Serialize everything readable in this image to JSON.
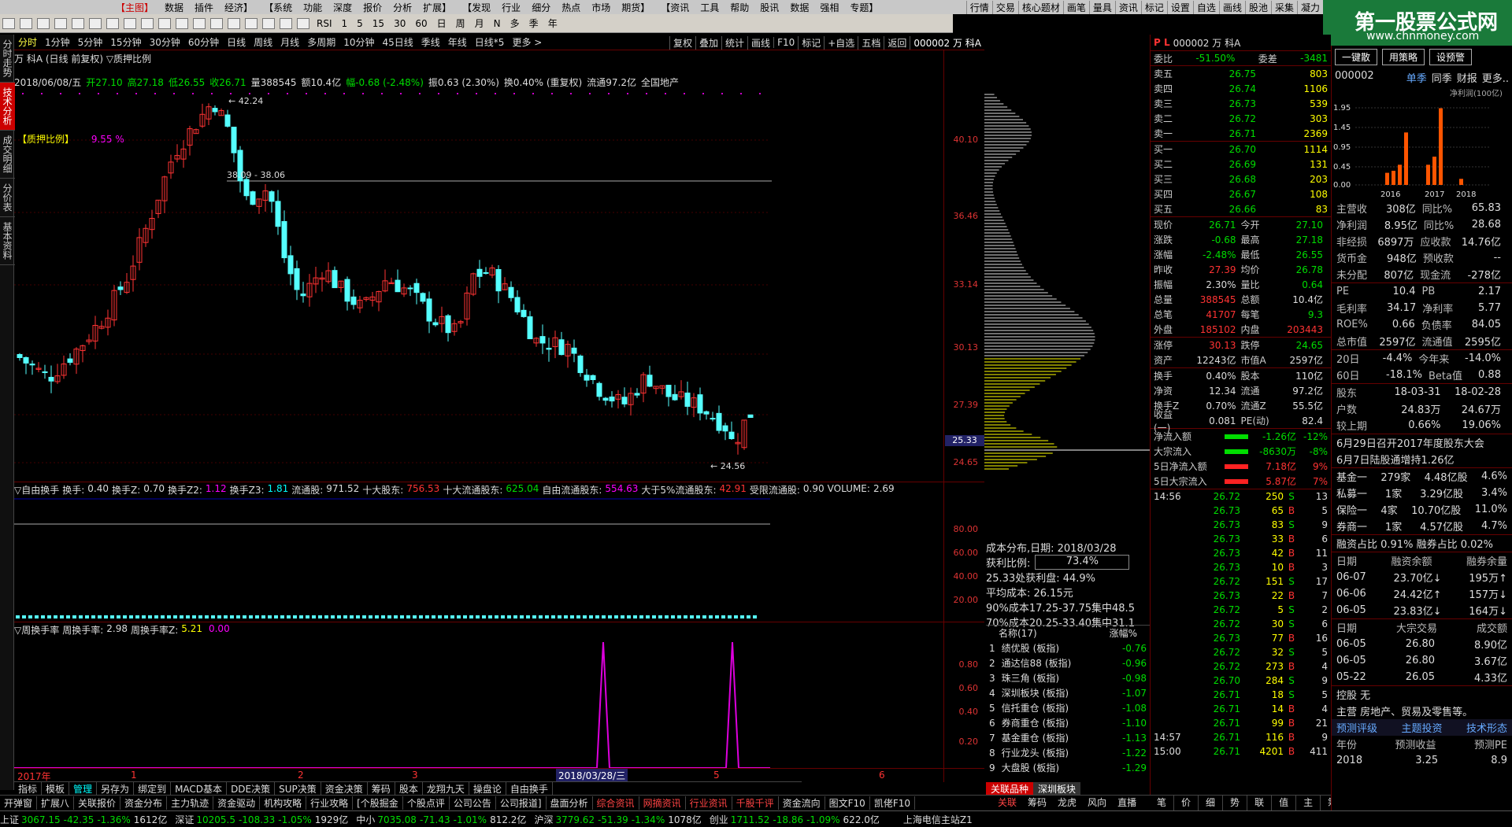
{
  "menu": [
    "【主图】",
    "数据",
    "插件",
    "经济】",
    "【系统",
    "功能",
    "深度",
    "报价",
    "分析",
    "扩展】",
    "【发现",
    "行业",
    "细分",
    "热点",
    "市场",
    "期货】",
    "【资讯",
    "工具",
    "帮助",
    "股讯",
    "数据",
    "强相",
    "专题】"
  ],
  "menu_right": [
    "行情",
    "交易",
    "核心题材",
    "画笔",
    "量具",
    "资讯",
    "标记",
    "设置",
    "自选",
    "画线",
    "股池",
    "采集",
    "凝力"
  ],
  "toolbar": [
    "RSI",
    "1",
    "5",
    "15",
    "30",
    "60",
    "日",
    "周",
    "月",
    "N",
    "多",
    "季",
    "年"
  ],
  "logo": {
    "title": "第一股票公式网",
    "url": "www.chnmoney.com"
  },
  "left_tabs": [
    "分时走势",
    "技术分析",
    "成交明细",
    "分价表",
    "基本资料"
  ],
  "chart_nav": [
    "分时",
    "1分钟",
    "5分钟",
    "15分钟",
    "30分钟",
    "60分钟",
    "日线",
    "周线",
    "月线",
    "多周期",
    "10分钟",
    "45日线",
    "季线",
    "年线",
    "日线*5",
    "更多 >"
  ],
  "right_nav": [
    "复权",
    "叠加",
    "统计",
    "画线",
    "F10",
    "标记",
    "+自选",
    "五档",
    "返回"
  ],
  "stock": {
    "title": "万 科A (日线 前复权) ▽质押比例",
    "code_name": "000002 万 科A",
    "info_date": "2018/06/08/五",
    "open": "开27.10",
    "high": "高27.18",
    "low": "低26.55",
    "close": "收26.71",
    "vol": "量388545",
    "amt": "额10.4亿",
    "chg": "幅-0.68 (-2.48%)",
    "amp": "振0.63 (2.30%)",
    "turn": "换0.40% (重复权)",
    "float": "流通97.2亿",
    "sector": "全国地产"
  },
  "chart_labels": {
    "pledge": "【质押比例】",
    "pledge_val": "9.55 %",
    "peak": "42.24",
    "range": "38.09 - 38.06",
    "low": "24.56",
    "cur": "25.33"
  },
  "price_axis": [
    "40.10",
    "36.46",
    "33.14",
    "30.13",
    "27.39",
    "24.65"
  ],
  "chart_data": {
    "type": "candlestick",
    "y_axis_ticks": [
      40.1,
      36.46,
      33.14,
      30.13,
      27.39,
      24.65
    ],
    "high": 42.24,
    "low": 24.56,
    "last": 26.71
  },
  "indicator1": {
    "label": "▽自由换手",
    "items": [
      {
        "k": "换手:",
        "v": "0.40",
        "c": "white"
      },
      {
        "k": "换手Z:",
        "v": "0.70",
        "c": "white"
      },
      {
        "k": "换手Z2:",
        "v": "1.12",
        "c": "mag"
      },
      {
        "k": "换手Z3:",
        "v": "1.81",
        "c": "cyan"
      },
      {
        "k": "流通股:",
        "v": "971.52",
        "c": "white"
      },
      {
        "k": "十大股东:",
        "v": "756.53",
        "c": "red"
      },
      {
        "k": "十大流通股东:",
        "v": "625.04",
        "c": "green"
      },
      {
        "k": "自由流通股东:",
        "v": "554.63",
        "c": "mag"
      },
      {
        "k": "大于5%流通股东:",
        "v": "42.91",
        "c": "red"
      },
      {
        "k": "受限流通股:",
        "v": "0.90",
        "c": "white"
      },
      {
        "k": "VOLUME:",
        "v": "2.69",
        "c": "white"
      }
    ],
    "axis": [
      "80.00",
      "60.00",
      "40.00",
      "20.00"
    ]
  },
  "indicator2": {
    "label": "▽周换手率",
    "items": [
      {
        "k": "周换手率:",
        "v": "2.98",
        "c": "white"
      },
      {
        "k": "周换手率Z:",
        "v": "5.21",
        "c": "yellow"
      },
      {
        "k": "",
        "v": "0.00",
        "c": "mag"
      }
    ],
    "axis": [
      "0.80",
      "0.60",
      "0.40",
      "0.20"
    ]
  },
  "x_axis": {
    "year": "2017年",
    "months": [
      "1",
      "2",
      "3",
      "5",
      "6"
    ],
    "cursor_date": "2018/03/28/三"
  },
  "ind_tabs": [
    "指标",
    "模板",
    "管理",
    "另存为",
    "绑定到",
    "MACD基本",
    "DDE决策",
    "SUP决策",
    "资金决策",
    "筹码",
    "股本",
    "龙翔九天",
    "操盘论",
    "自由换手"
  ],
  "bottom_tabs": [
    "开弹窗",
    "扩展八",
    "关联报价",
    "资金分布",
    "主力轨迹",
    "资金驱动",
    "机构攻略",
    "行业攻略",
    "[个股掘金",
    "个股点评",
    "公司公告",
    "公司报道]",
    "盘面分析",
    "综合资讯",
    "网摘资讯",
    "行业资讯",
    "千股千评",
    "资金流向",
    "图文F10",
    "凯佬F10"
  ],
  "cost": {
    "title": "成本分布,日期: 2018/03/28",
    "profit_label": "获利比例:",
    "profit": "73.4%",
    "line1": "25.33处获利盘: 44.9%",
    "avg": "平均成本: 26.15元",
    "l90": "90%成本17.25-37.75集中48.5",
    "l70": "70%成本20.25-33.40集中31.1"
  },
  "related": {
    "header": "名称(17)",
    "header2": "涨幅%",
    "rows": [
      {
        "n": "1",
        "name": "绩优股",
        "tag": "(板指)",
        "v": "-0.76"
      },
      {
        "n": "2",
        "name": "通达信88",
        "tag": "(板指)",
        "v": "-0.96"
      },
      {
        "n": "3",
        "name": "珠三角",
        "tag": "(板指)",
        "v": "-0.98"
      },
      {
        "n": "4",
        "name": "深圳板块",
        "tag": "(板指)",
        "v": "-1.07"
      },
      {
        "n": "5",
        "name": "信托重仓",
        "tag": "(板指)",
        "v": "-1.08"
      },
      {
        "n": "6",
        "name": "券商重仓",
        "tag": "(板指)",
        "v": "-1.10"
      },
      {
        "n": "7",
        "name": "基金重仓",
        "tag": "(板指)",
        "v": "-1.13"
      },
      {
        "n": "8",
        "name": "行业龙头",
        "tag": "(板指)",
        "v": "-1.22"
      },
      {
        "n": "9",
        "name": "大盘股",
        "tag": "(板指)",
        "v": "-1.29"
      }
    ],
    "tabs": [
      "关联品种",
      "深圳板块"
    ]
  },
  "quote": {
    "code": "000002 万 科A",
    "weibi": "委比",
    "weibi_v": "-51.50%",
    "weicha": "委差",
    "weicha_v": "-3481",
    "sell": [
      [
        "卖五",
        "26.75",
        "803"
      ],
      [
        "卖四",
        "26.74",
        "1106"
      ],
      [
        "卖三",
        "26.73",
        "539"
      ],
      [
        "卖二",
        "26.72",
        "303"
      ],
      [
        "卖一",
        "26.71",
        "2369"
      ]
    ],
    "buy": [
      [
        "买一",
        "26.70",
        "1114"
      ],
      [
        "买二",
        "26.69",
        "131"
      ],
      [
        "买三",
        "26.68",
        "203"
      ],
      [
        "买四",
        "26.67",
        "108"
      ],
      [
        "买五",
        "26.66",
        "83"
      ]
    ],
    "stats": [
      [
        "现价",
        "26.71",
        "今开",
        "27.10"
      ],
      [
        "涨跌",
        "-0.68",
        "最高",
        "27.18"
      ],
      [
        "涨幅",
        "-2.48%",
        "最低",
        "26.55"
      ],
      [
        "昨收",
        "27.39",
        "均价",
        "26.78"
      ],
      [
        "振幅",
        "2.30%",
        "量比",
        "0.64"
      ],
      [
        "总量",
        "388545",
        "总额",
        "10.4亿"
      ],
      [
        "总笔",
        "41707",
        "每笔",
        "9.3"
      ],
      [
        "外盘",
        "185102",
        "内盘",
        "203443"
      ]
    ],
    "stats2": [
      [
        "涨停",
        "30.13",
        "跌停",
        "24.65"
      ],
      [
        "资产",
        "12243亿",
        "市值A",
        "2597亿"
      ]
    ],
    "stats3": [
      [
        "换手",
        "0.40%",
        "股本",
        "110亿"
      ],
      [
        "净资",
        "12.34",
        "流通",
        "97.2亿"
      ],
      [
        "换手Z",
        "0.70%",
        "流通Z",
        "55.5亿"
      ],
      [
        "收益(一)",
        "0.081",
        "PE(动)",
        "82.4"
      ]
    ],
    "flow": [
      [
        "净流入额",
        "-1.26亿",
        "-12%"
      ],
      [
        "大宗流入",
        "-8630万",
        "-8%"
      ],
      [
        "5日净流入额",
        "7.18亿",
        "9%"
      ],
      [
        "5日大宗流入",
        "5.87亿",
        "7%"
      ]
    ],
    "ticks": [
      [
        "14:56",
        "26.72",
        "250",
        "S",
        "13"
      ],
      [
        "",
        "26.73",
        "65",
        "B",
        "5"
      ],
      [
        "",
        "26.73",
        "83",
        "S",
        "9"
      ],
      [
        "",
        "26.73",
        "33",
        "B",
        "6"
      ],
      [
        "",
        "26.73",
        "42",
        "B",
        "11"
      ],
      [
        "",
        "26.73",
        "10",
        "B",
        "3"
      ],
      [
        "",
        "26.72",
        "151",
        "S",
        "17"
      ],
      [
        "",
        "26.73",
        "22",
        "B",
        "7"
      ],
      [
        "",
        "26.72",
        "5",
        "S",
        "2"
      ],
      [
        "",
        "26.72",
        "30",
        "S",
        "6"
      ],
      [
        "",
        "26.73",
        "77",
        "B",
        "16"
      ],
      [
        "",
        "26.72",
        "32",
        "S",
        "5"
      ],
      [
        "",
        "26.72",
        "273",
        "B",
        "4"
      ],
      [
        "",
        "26.70",
        "284",
        "S",
        "9"
      ],
      [
        "",
        "26.71",
        "18",
        "S",
        "5"
      ],
      [
        "",
        "26.71",
        "14",
        "B",
        "4"
      ],
      [
        "",
        "26.71",
        "99",
        "B",
        "21"
      ],
      [
        "14:57",
        "26.71",
        "116",
        "B",
        "9"
      ],
      [
        "15:00",
        "26.71",
        "4201",
        "B",
        "411"
      ]
    ],
    "bottom_tabs": [
      "笔",
      "价",
      "细",
      "势",
      "联",
      "值",
      "主",
      "筹"
    ]
  },
  "fin": {
    "btns": [
      "一键散",
      "用策略",
      "设预警"
    ],
    "code": "000002",
    "tabs": [
      "单季",
      "同季",
      "财报",
      "更多.."
    ],
    "chart_title": "净利润(100亿)",
    "chart_y": [
      "1.95",
      "1.45",
      "0.95",
      "0.45",
      "0.00"
    ],
    "chart_x": [
      "2016",
      "2017",
      "2018"
    ],
    "rows": [
      [
        "主营收",
        "308亿",
        "同比%",
        "65.83"
      ],
      [
        "净利润",
        "8.95亿",
        "同比%",
        "28.68"
      ],
      [
        "非经损",
        "6897万",
        "应收款",
        "14.76亿"
      ],
      [
        "货币金",
        "948亿",
        "预收款",
        "--"
      ],
      [
        "未分配",
        "807亿",
        "现金流",
        "-278亿"
      ]
    ],
    "rows2": [
      [
        "PE",
        "10.4",
        "PB",
        "2.17"
      ],
      [
        "毛利率",
        "34.17",
        "净利率",
        "5.77"
      ],
      [
        "ROE%",
        "0.66",
        "负债率",
        "84.05"
      ],
      [
        "总市值",
        "2597亿",
        "流通值",
        "2595亿"
      ]
    ],
    "rows3": [
      [
        "20日",
        "-4.4%",
        "今年来",
        "-14.0%"
      ],
      [
        "60日",
        "-18.1%",
        "Beta值",
        "0.88"
      ]
    ],
    "rows4": [
      [
        "股东",
        "18-03-31",
        "",
        "18-02-28"
      ],
      [
        "户数",
        "24.83万",
        "",
        "24.67万"
      ],
      [
        "较上期",
        "0.66%",
        "",
        "19.06%"
      ]
    ],
    "news": [
      "6月29日召开2017年度股东大会",
      "6月7日陆股通增持1.26亿"
    ],
    "holders": [
      [
        "基金一",
        "279家",
        "4.48亿股",
        "4.6%"
      ],
      [
        "私募一",
        "1家",
        "3.29亿股",
        "3.4%"
      ],
      [
        "保险一",
        "4家",
        "10.70亿股",
        "11.0%"
      ],
      [
        "券商一",
        "1家",
        "4.57亿股",
        "4.7%"
      ]
    ],
    "margin": "融资占比 0.91% 融券占比 0.02%",
    "margin_head": [
      "日期",
      "融资余额",
      "融券余量"
    ],
    "margin_rows": [
      [
        "06-07",
        "23.70亿↓",
        "195万↑"
      ],
      [
        "06-06",
        "24.42亿↑",
        "157万↓"
      ],
      [
        "06-05",
        "23.83亿↓",
        "164万↓"
      ]
    ],
    "block_head": [
      "日期",
      "大宗交易",
      "成交额"
    ],
    "block_rows": [
      [
        "06-05",
        "26.80",
        "8.90亿"
      ],
      [
        "06-05",
        "26.80",
        "3.67亿"
      ],
      [
        "05-22",
        "26.05",
        "4.33亿"
      ]
    ],
    "control": "控股 无",
    "main_biz": "主营 房地产、贸易及零售等。",
    "fin_tabs": [
      "预测评级",
      "主题投资",
      "技术形态"
    ],
    "forecast_head": [
      "年份",
      "预测收益",
      "预测PE"
    ],
    "forecast": [
      "2018",
      "3.25",
      "8.9"
    ]
  },
  "status": {
    "items": [
      {
        "t": "上证",
        "v": "3067.15",
        "c": "-42.35",
        "p": "-1.36%",
        "a": "1612亿"
      },
      {
        "t": "深证",
        "v": "10205.5",
        "c": "-108.33",
        "p": "-1.05%",
        "a": "1929亿"
      },
      {
        "t": "中小",
        "v": "7035.08",
        "c": "-71.43",
        "p": "-1.01%",
        "a": "812.2亿"
      },
      {
        "t": "沪深",
        "v": "3779.62",
        "c": "-51.39",
        "p": "-1.34%",
        "a": "1078亿"
      },
      {
        "t": "创业",
        "v": "1711.52",
        "c": "-18.86",
        "p": "-1.09%",
        "a": "622.0亿"
      }
    ],
    "server": "上海电信主站Z1"
  },
  "side_tabs": [
    "关联",
    "筹码",
    "龙虎",
    "风向",
    "直播"
  ]
}
